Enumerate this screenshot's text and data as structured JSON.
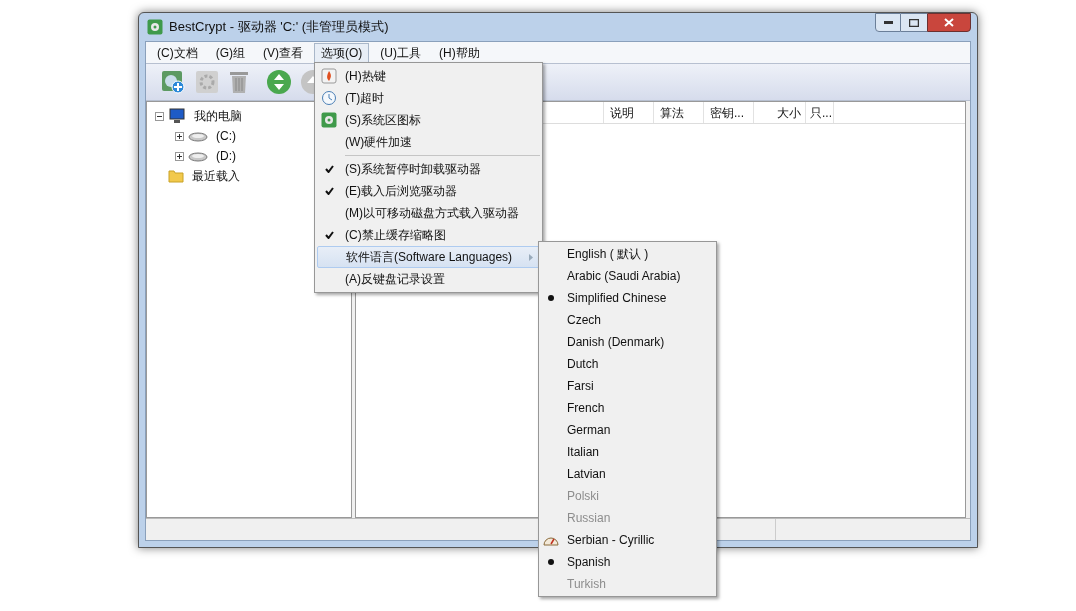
{
  "window": {
    "title": "BestCrypt - 驱动器 'C:' (非管理员模式)"
  },
  "menu_bar": [
    {
      "label": "(C)文档",
      "selected": false
    },
    {
      "label": "(G)组",
      "selected": false
    },
    {
      "label": "(V)查看",
      "selected": false
    },
    {
      "label": "选项(O)",
      "selected": true
    },
    {
      "label": "(U)工具",
      "selected": false
    },
    {
      "label": "(H)帮助",
      "selected": false
    }
  ],
  "tree": [
    {
      "label": "我的电脑",
      "expanded": true,
      "children": [
        {
          "label": "(C:)",
          "expanded": false
        },
        {
          "label": "(D:)",
          "expanded": false
        }
      ]
    },
    {
      "label": "最近载入"
    }
  ],
  "table": {
    "columns": [
      "",
      "说明",
      "算法",
      "密钥...",
      "大小",
      "只..."
    ]
  },
  "options_menu": [
    {
      "label": "(H)热键",
      "kind": "icon",
      "checked": false
    },
    {
      "label": "(T)超时",
      "kind": "icon",
      "checked": false
    },
    {
      "label": "(S)系统区图标",
      "kind": "icon",
      "checked": false
    },
    {
      "label": "(W)硬件加速",
      "kind": "plain",
      "checked": false
    },
    {
      "label": "(S)系统暂停时卸载驱动器",
      "kind": "plain",
      "checked": true
    },
    {
      "label": "(E)载入后浏览驱动器",
      "kind": "plain",
      "checked": true
    },
    {
      "label": "(M)以可移动磁盘方式载入驱动器",
      "kind": "plain",
      "checked": false
    },
    {
      "label": "(C)禁止缓存缩略图",
      "kind": "plain",
      "checked": true
    },
    {
      "label": "软件语言(Software Languages)",
      "kind": "submenu",
      "checked": false
    },
    {
      "label": "(A)反键盘记录设置",
      "kind": "plain",
      "checked": false
    }
  ],
  "languages_menu": [
    {
      "label": "English ( 默认 )",
      "selected": false,
      "disabled": false,
      "kind": "plain"
    },
    {
      "label": "Arabic (Saudi Arabia)",
      "selected": false,
      "disabled": false,
      "kind": "plain"
    },
    {
      "label": "Simplified Chinese",
      "selected": true,
      "disabled": false,
      "kind": "plain"
    },
    {
      "label": "Czech",
      "selected": false,
      "disabled": false,
      "kind": "plain"
    },
    {
      "label": "Danish (Denmark)",
      "selected": false,
      "disabled": false,
      "kind": "plain"
    },
    {
      "label": "Dutch",
      "selected": false,
      "disabled": false,
      "kind": "plain"
    },
    {
      "label": "Farsi",
      "selected": false,
      "disabled": false,
      "kind": "plain"
    },
    {
      "label": "French",
      "selected": false,
      "disabled": false,
      "kind": "plain"
    },
    {
      "label": "German",
      "selected": false,
      "disabled": false,
      "kind": "plain"
    },
    {
      "label": "Italian",
      "selected": false,
      "disabled": false,
      "kind": "plain"
    },
    {
      "label": "Latvian",
      "selected": false,
      "disabled": false,
      "kind": "plain"
    },
    {
      "label": "Polski",
      "selected": false,
      "disabled": true,
      "kind": "plain"
    },
    {
      "label": "Russian",
      "selected": false,
      "disabled": true,
      "kind": "plain"
    },
    {
      "label": "Serbian - Cyrillic",
      "selected": false,
      "disabled": false,
      "kind": "icon"
    },
    {
      "label": "Spanish",
      "selected": true,
      "disabled": false,
      "kind": "plain"
    },
    {
      "label": "Turkish",
      "selected": false,
      "disabled": true,
      "kind": "plain"
    }
  ]
}
